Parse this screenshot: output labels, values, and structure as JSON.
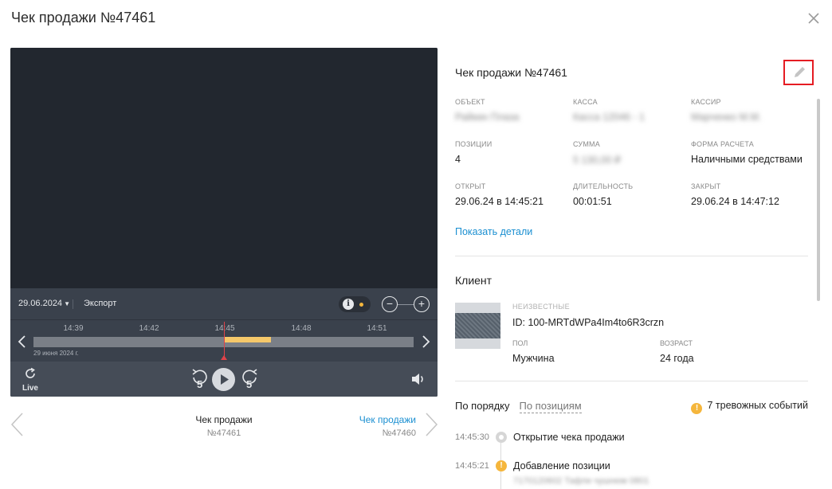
{
  "modal": {
    "title": "Чек продажи №47461",
    "close_icon": "close-icon"
  },
  "player": {
    "date": "29.06.2024",
    "export_label": "Экспорт",
    "info_icon_label": "i",
    "zoom_out_label": "−",
    "zoom_in_label": "+",
    "timeline": {
      "ticks": [
        "14:39",
        "14:42",
        "14:45",
        "14:48",
        "14:51"
      ],
      "date_label": "29 июня 2024 г.",
      "fill_start_fraction": 0.5,
      "fill_end_fraction": 0.625,
      "cursor_time": "14:45"
    },
    "live_label": "Live",
    "rewind_seconds": "5",
    "forward_seconds": "5"
  },
  "navigation": {
    "current": {
      "title": "Чек продажи",
      "number": "№47461"
    },
    "next": {
      "title": "Чек продажи",
      "number": "№47460"
    }
  },
  "receipt": {
    "title": "Чек продажи №47461",
    "edit_icon": "pencil-icon",
    "fields": {
      "object": {
        "label": "ОБЪЕКТ",
        "value": "Райкин Плаза"
      },
      "register": {
        "label": "КАССА",
        "value": "Касса 12046 - 1"
      },
      "cashier": {
        "label": "КАССИР",
        "value": "Марченко М.М."
      },
      "positions": {
        "label": "ПОЗИЦИИ",
        "value": "4"
      },
      "sum": {
        "label": "СУММА",
        "value": "5 130,00 ₽"
      },
      "payment": {
        "label": "ФОРМА РАСЧЕТА",
        "value": "Наличными средствами"
      },
      "opened": {
        "label": "ОТКРЫТ",
        "value": "29.06.24 в 14:45:21"
      },
      "duration": {
        "label": "ДЛИТЕЛЬНОСТЬ",
        "value": "00:01:51"
      },
      "closed": {
        "label": "ЗАКРЫТ",
        "value": "29.06.24 в 14:47:12"
      }
    },
    "show_details_label": "Показать детали"
  },
  "client": {
    "section_title": "Клиент",
    "tag": "НЕИЗВЕСТНЫЕ",
    "id": "ID: 100-MRTdWPa4Im4to6R3crzn",
    "gender": {
      "label": "ПОЛ",
      "value": "Мужчина"
    },
    "age": {
      "label": "ВОЗРАСТ",
      "value": "24 года"
    }
  },
  "events": {
    "tab_order": "По порядку",
    "tab_positions": "По позициям",
    "alerts_icon_label": "!",
    "alerts_text": "7 тревожных событий",
    "items": [
      {
        "time": "14:45:30",
        "title": "Открытие чека продажи",
        "sub": "",
        "marker_label": ""
      },
      {
        "time": "14:45:21",
        "title": "Добавление позиции",
        "sub": "7170120602 Тафли чушнюм 0801",
        "marker_label": "!"
      }
    ]
  },
  "colors": {
    "accent": "#1a8fd1",
    "warning": "#f5b63c",
    "highlight_box": "#e51c23",
    "player_bg": "#22272f",
    "timeline_fill": "#f5c86a",
    "cursor": "#e0434a"
  }
}
